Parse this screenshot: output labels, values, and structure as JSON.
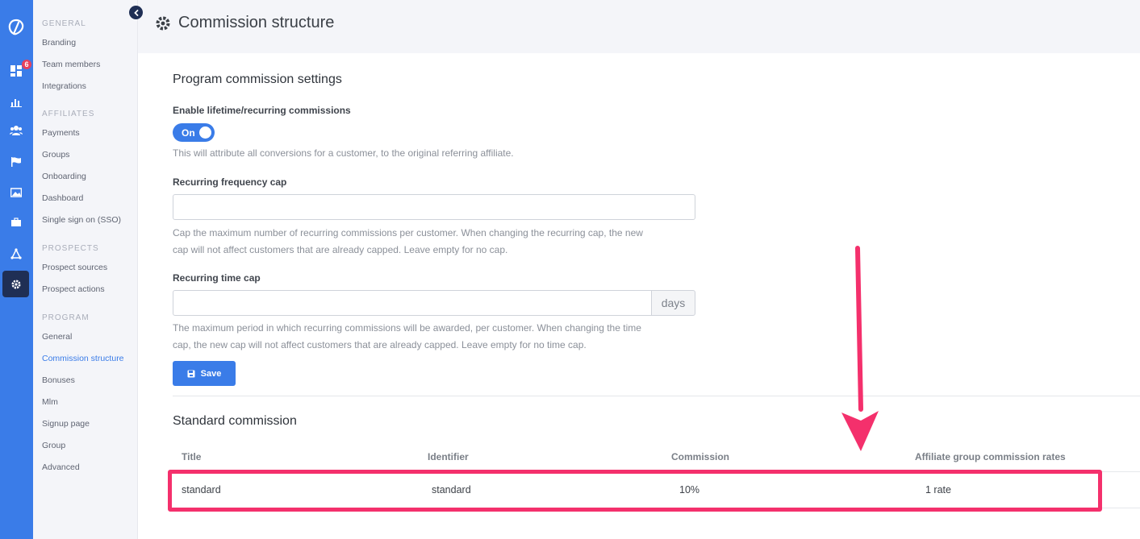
{
  "sidebar": {
    "badge_count": "6",
    "groups": [
      {
        "heading": "GENERAL",
        "items": [
          "Branding",
          "Team members",
          "Integrations"
        ]
      },
      {
        "heading": "AFFILIATES",
        "items": [
          "Payments",
          "Groups",
          "Onboarding",
          "Dashboard",
          "Single sign on (SSO)"
        ]
      },
      {
        "heading": "PROSPECTS",
        "items": [
          "Prospect sources",
          "Prospect actions"
        ]
      },
      {
        "heading": "PROGRAM",
        "items": [
          "General",
          "Commission structure",
          "Bonuses",
          "Mlm",
          "Signup page",
          "Group",
          "Advanced"
        ]
      }
    ],
    "active_item": "Commission structure"
  },
  "header": {
    "title": "Commission structure"
  },
  "settings": {
    "heading": "Program commission settings",
    "lifetime_label": "Enable lifetime/recurring commissions",
    "toggle_state": "On",
    "lifetime_help": "This will attribute all conversions for a customer, to the original referring affiliate.",
    "freq_cap_label": "Recurring frequency cap",
    "freq_cap_value": "",
    "freq_cap_help_1": "Cap the maximum number of recurring commissions per customer. When changing the recurring cap, the new",
    "freq_cap_help_2": "cap will not affect customers that are already capped. Leave empty for no cap.",
    "time_cap_label": "Recurring time cap",
    "time_cap_value": "",
    "time_cap_unit": "days",
    "time_cap_help_1": "The maximum period in which recurring commissions will be awarded, per customer. When changing the time",
    "time_cap_help_2": "cap, the new cap will not affect customers that are already capped. Leave empty for no time cap.",
    "save_label": "Save"
  },
  "standard": {
    "heading": "Standard commission",
    "columns": [
      "Title",
      "Identifier",
      "Commission",
      "Affiliate group commission rates"
    ],
    "rows": [
      {
        "title": "standard",
        "identifier": "standard",
        "commission": "10%",
        "rates": "1 rate"
      }
    ]
  },
  "colors": {
    "accent": "#3a7ce8",
    "highlight": "#f4306c",
    "rail": "#3a7ce8",
    "active_rail": "#1f2f55"
  }
}
